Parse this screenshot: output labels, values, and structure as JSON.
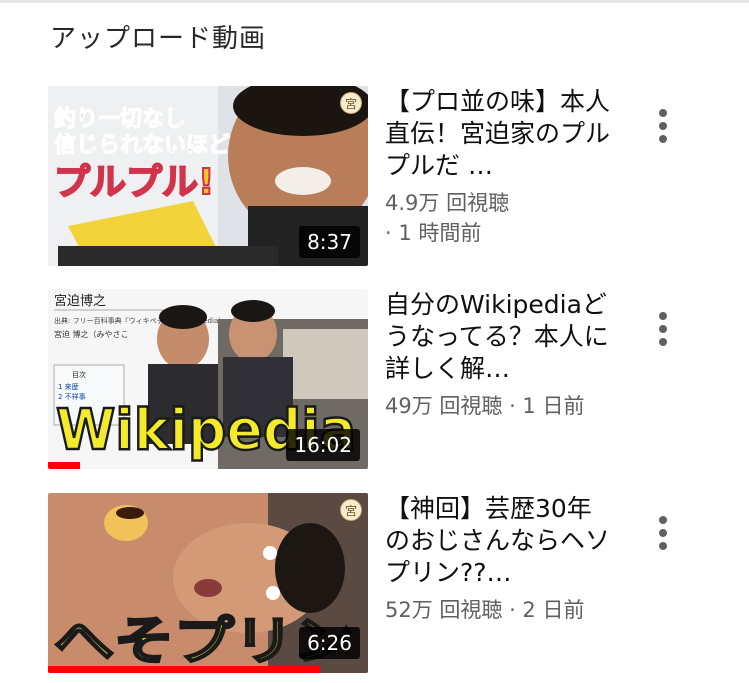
{
  "section": {
    "title": "アップロード動画"
  },
  "videos": [
    {
      "title": "【プロ並の味】本人直伝！宮迫家のプルプルだ …",
      "views": "4.9万 回視聴",
      "age": "· 1 時間前",
      "duration": "8:37",
      "thumb_text_1": "釣り一切なし",
      "thumb_text_2": "信じられないほど",
      "thumb_text_3": "プルプル!",
      "channel_badge": "宮",
      "watched_fraction": 0
    },
    {
      "title": "自分のWikipediaどうなってる？本人に詳しく解…",
      "views_age": "49万 回視聴 · 1 日前",
      "duration": "16:02",
      "thumb_text_big": "Wikipedia",
      "wiki_title": "宮迫博之",
      "wiki_source": "出典: フリー百科事典『ウィキペディア（Wikipedia）』",
      "wiki_line": "宮迫 博之（みやさこ",
      "wiki_toc": "目次",
      "wiki_toc_1": "1 来歴",
      "wiki_toc_2": "2 不祥事",
      "watched_fraction": 0.1
    },
    {
      "title": "【神回】芸歴30年のおじさんならヘソプリン??…",
      "views_age": "52万 回視聴 · 2 日前",
      "duration": "6:26",
      "thumb_text_big": "へそプリン",
      "channel_badge": "宮",
      "watched_fraction": 0.85
    }
  ]
}
